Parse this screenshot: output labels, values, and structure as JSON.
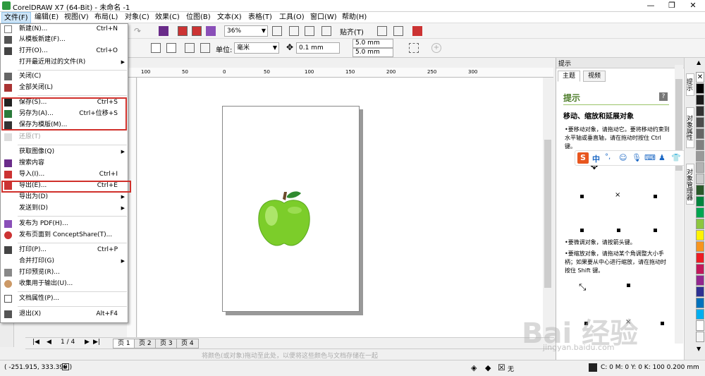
{
  "window": {
    "title": "CorelDRAW X7 (64-Bit) - 未命名 -1",
    "minimize": "—",
    "maximize": "❐",
    "close": "✕"
  },
  "menubar": [
    {
      "label": "文件(F)"
    },
    {
      "label": "编辑(E)"
    },
    {
      "label": "视图(V)"
    },
    {
      "label": "布局(L)"
    },
    {
      "label": "对象(C)"
    },
    {
      "label": "效果(C)"
    },
    {
      "label": "位图(B)"
    },
    {
      "label": "文本(X)"
    },
    {
      "label": "表格(T)"
    },
    {
      "label": "工具(O)"
    },
    {
      "label": "窗口(W)"
    },
    {
      "label": "帮助(H)"
    }
  ],
  "toolbar": {
    "zoom": "36%",
    "snap": "贴齐(T)",
    "unit_label": "单位:",
    "unit": "毫米",
    "nudge": "0.1 mm",
    "dup_x": "5.0 mm",
    "dup_y": "5.0 mm"
  },
  "ruler_ticks": [
    "100",
    "50",
    "0",
    "50",
    "100",
    "150",
    "200",
    "250",
    "300"
  ],
  "file_menu": [
    {
      "label": "新建(N)...",
      "shortcut": "Ctrl+N"
    },
    {
      "label": "从模板新建(F)..."
    },
    {
      "label": "打开(O)...",
      "shortcut": "Ctrl+O"
    },
    {
      "label": "打开最近用过的文件(R)",
      "submenu": "▶"
    },
    {
      "label": "关闭(C)"
    },
    {
      "label": "全部关闭(L)"
    },
    {
      "label": "保存(S)...",
      "shortcut": "Ctrl+S"
    },
    {
      "label": "另存为(A)...",
      "shortcut": "Ctrl+位移+S"
    },
    {
      "label": "保存为模版(M)..."
    },
    {
      "label": "还原(T)"
    },
    {
      "label": "获取图像(Q)",
      "submenu": "▶"
    },
    {
      "label": "搜索内容"
    },
    {
      "label": "导入(I)...",
      "shortcut": "Ctrl+I"
    },
    {
      "label": "导出(E)...",
      "shortcut": "Ctrl+E"
    },
    {
      "label": "导出为(D)",
      "submenu": "▶"
    },
    {
      "label": "发送到(D)",
      "submenu": "▶"
    },
    {
      "label": "发布为 PDF(H)..."
    },
    {
      "label": "发布页面到 ConceptShare(T)..."
    },
    {
      "label": "打印(P)...",
      "shortcut": "Ctrl+P"
    },
    {
      "label": "合并打印(G)",
      "submenu": "▶"
    },
    {
      "label": "打印预览(R)..."
    },
    {
      "label": "收集用于输出(U)..."
    },
    {
      "label": "文档属性(P)..."
    },
    {
      "label": "退出(X)",
      "shortcut": "Alt+F4"
    }
  ],
  "page_nav": {
    "current": "1 / 4",
    "tabs": [
      "页 1",
      "页 2",
      "页 3",
      "页 4"
    ]
  },
  "color_hint": "将颜色(或对象)拖动至此处，以便将这些颜色与文档存储在一起",
  "docker": {
    "header": "提示",
    "tabs": [
      "主题",
      "视频"
    ],
    "title": "提示",
    "heading": "移动、缩放和延展对象",
    "p1": "•要移动对象，请拖动它。要将移动约束到水平轴或垂直轴，请在拖动时按住 Ctrl 键。",
    "p2": "•要微调对象，请按箭头键。",
    "p3": "•要缩放对象，请拖动某个角调整大小手柄；如果要从中心进行缩放，请在拖动时按住 Shift 键。",
    "help": "?"
  },
  "vtabs": [
    "提示",
    "对象属性",
    "对象管理器"
  ],
  "ime": {
    "label": "中"
  },
  "status": {
    "coords": "( -251.915, 333.390 )",
    "none": "无",
    "fill": "C: 0 M: 0 Y: 0 K: 100  0.200 mm"
  },
  "watermark": {
    "main": "Bai",
    "main2": "经验",
    "sub": "jingyan.baidu.com"
  },
  "palette": [
    "#ffffff",
    "#000000",
    "#1a1a1a",
    "#333333",
    "#4d4d4d",
    "#666666",
    "#808080",
    "#999999",
    "#b3b3b3",
    "#cccccc",
    "#e6e6e6",
    "#2a5a2a",
    "#00843d",
    "#00a651",
    "#8dc63f",
    "#fff200",
    "#f7941d",
    "#ed1c24",
    "#c2185b",
    "#92278f",
    "#2e3192",
    "#0072bc",
    "#00aeef",
    "#ffffff",
    "#f5f5f5"
  ]
}
